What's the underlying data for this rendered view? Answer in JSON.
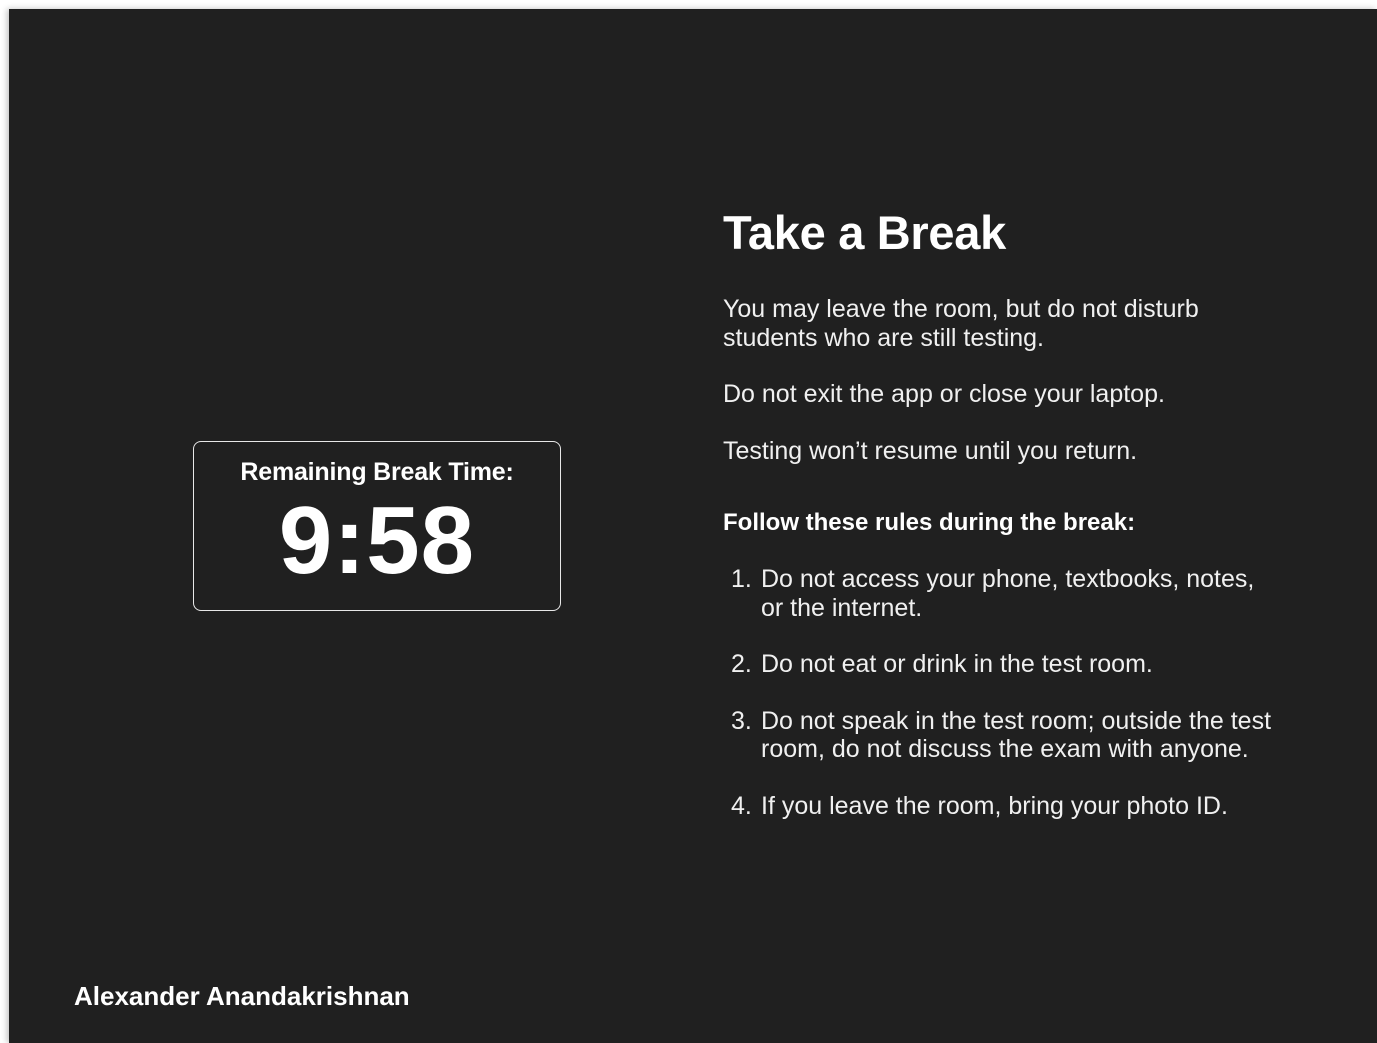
{
  "timer": {
    "label": "Remaining Break Time:",
    "value": "9:58"
  },
  "break_info": {
    "title": "Take a Break",
    "paragraphs": [
      "You may leave the room, but do not disturb students who are still testing.",
      "Do not exit the app or close your laptop.",
      "Testing won’t resume until you return."
    ],
    "rules_heading": "Follow these rules during the break:",
    "rules": [
      {
        "num": "1.",
        "text": "Do not access your phone, textbooks, notes, or the internet."
      },
      {
        "num": "2.",
        "text": "Do not eat or drink in the test room."
      },
      {
        "num": "3.",
        "text": "Do not speak in the test room; outside the test room, do not discuss the exam with anyone."
      },
      {
        "num": "4.",
        "text": "If you leave the room, bring your photo ID."
      }
    ]
  },
  "user": {
    "name": "Alexander Anandakrishnan"
  },
  "colors": {
    "background": "#202020",
    "text": "#ffffff",
    "border": "#e8e8e8"
  }
}
